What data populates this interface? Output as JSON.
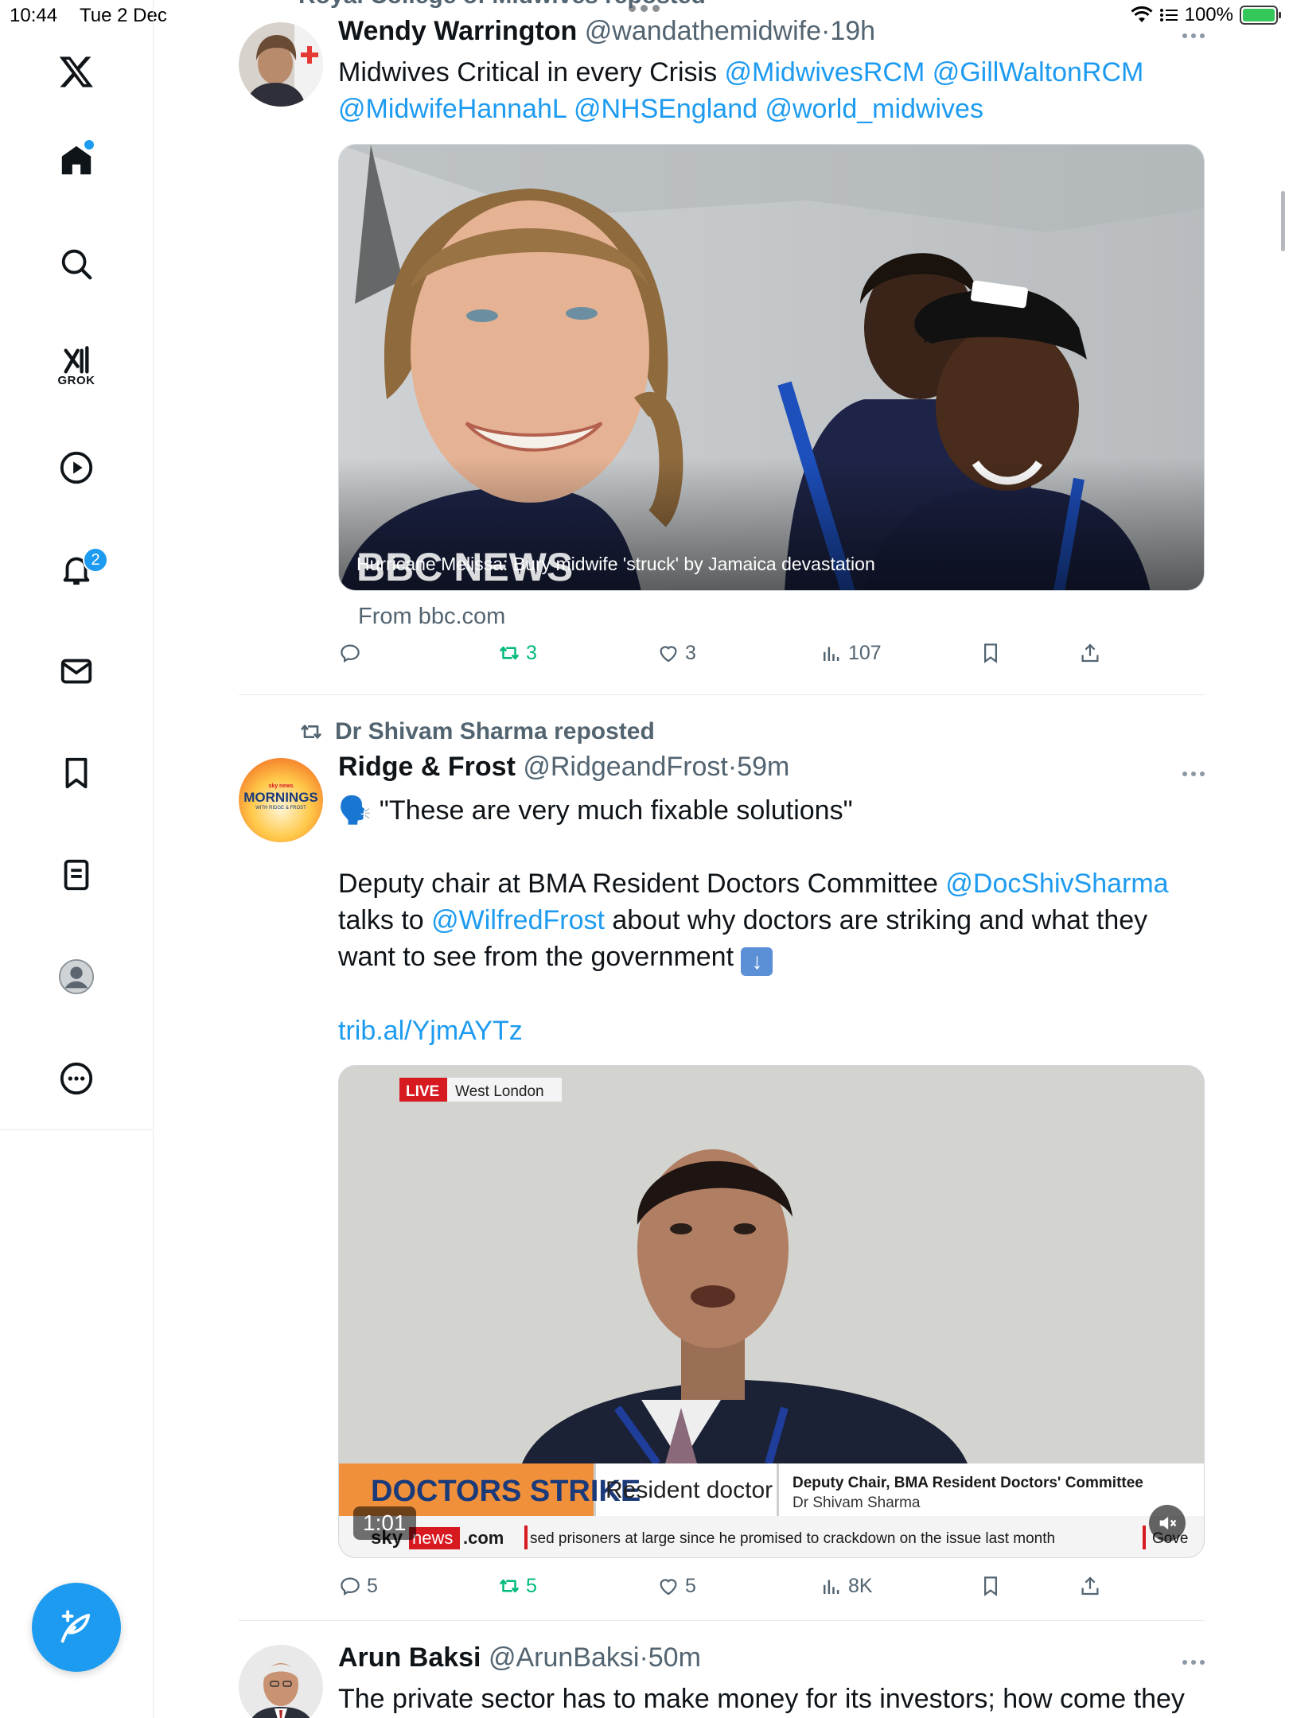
{
  "status_bar": {
    "time": "10:44",
    "date": "Tue 2 Dec",
    "battery": "100%"
  },
  "sidebar": {
    "items": [
      {
        "name": "x-logo"
      },
      {
        "name": "home"
      },
      {
        "name": "search"
      },
      {
        "name": "grok",
        "label": "GROK"
      },
      {
        "name": "videos"
      },
      {
        "name": "notifications",
        "badge": "2"
      },
      {
        "name": "messages"
      },
      {
        "name": "bookmarks"
      },
      {
        "name": "lists"
      },
      {
        "name": "profile"
      },
      {
        "name": "more"
      }
    ]
  },
  "accent_color": "#1d9bf0",
  "feed": {
    "tweet1": {
      "repost_line_partial": "Royal College of Midwives reposted",
      "name": "Wendy Warrington",
      "handle": "@wandathemidwife",
      "time": "19h",
      "text_plain": "Midwives Critical in every Crisis ",
      "mentions_line1": "@MidwivesRCM @GillWaltonRCM",
      "mentions_line2": "@MidwifeHannahL @NHSEngland @world_midwives",
      "card_watermark": "BBC NEWS",
      "card_title": "Hurricane Melissa: Bury midwife 'struck' by Jamaica devastation",
      "card_source": "From bbc.com",
      "reposts": "3",
      "likes": "3",
      "views": "107"
    },
    "tweet2": {
      "reposted_by": "Dr Shivam Sharma reposted",
      "name": "Ridge & Frost",
      "handle": "@RidgeandFrost",
      "time": "59m",
      "avatar_text_top": "sky news",
      "avatar_text": "MORNINGS",
      "avatar_sub": "WITH RIDGE & FROST",
      "line1": "\"These are very much fixable solutions\"",
      "line2a": "Deputy chair at BMA Resident Doctors Committee ",
      "line2_mention": "@DocShivSharma",
      "line3a": "talks to ",
      "line3_mention": "@WilfredFrost",
      "line3b": " about why doctors are striking and what they",
      "line4": "want to see from the government ",
      "link": "trib.al/YjmAYTz",
      "video": {
        "live": "LIVE",
        "location": "West London",
        "strap": "DOCTORS STRIKE",
        "headline": "Resident doctor",
        "role": "Deputy Chair, BMA Resident Doctors' Committee",
        "person": "Dr Shivam Sharma",
        "ticker_brand_a": "sky",
        "ticker_brand_b": "news",
        "ticker_brand_c": ".com",
        "ticker": "sed prisoners at large since he promised to crackdown on the issue last month",
        "ticker_tail": "Gove",
        "duration": "1:01"
      },
      "replies": "5",
      "reposts": "5",
      "likes": "5",
      "views": "8K"
    },
    "tweet3": {
      "name": "Arun Baksi",
      "handle": "@ArunBaksi",
      "time": "50m",
      "text": "The private sector has to make money for its investors; how come they"
    }
  }
}
